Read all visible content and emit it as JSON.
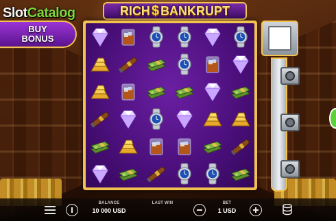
{
  "watermark": {
    "part_a": "Slot",
    "part_b": "Catalog"
  },
  "title": {
    "left": "RICH",
    "symbol": "$",
    "right": "BANKRUPT"
  },
  "buy_bonus": {
    "line1": "BUY",
    "line2": "BONUS"
  },
  "grid": {
    "rows": [
      [
        "diamond",
        "whiskey",
        "watch",
        "watch",
        "diamond",
        "watch"
      ],
      [
        "gold-bars",
        "cigar",
        "money",
        "watch",
        "whiskey",
        "diamond"
      ],
      [
        "gold-bars",
        "whiskey",
        "money",
        "money",
        "diamond",
        "money"
      ],
      [
        "cigar",
        "diamond",
        "watch",
        "diamond",
        "gold-bars",
        "gold-bars"
      ],
      [
        "money",
        "gold-bars",
        "whiskey",
        "whiskey",
        "money",
        "cigar"
      ],
      [
        "diamond",
        "money",
        "cigar",
        "watch",
        "watch",
        "money"
      ]
    ]
  },
  "meter": {
    "fill_fraction": 0.0,
    "locks": 3
  },
  "bottom_bar": {
    "balance_label": "BALANCE",
    "balance_value": "10 000 USD",
    "last_win_label": "LAST WIN",
    "last_win_value": "",
    "bet_label": "BET",
    "bet_value": "1 USD"
  },
  "colors": {
    "frame_gold": "#f2c14e",
    "grid_purple": "#4a0f7a",
    "accent_green": "#5ccf3a"
  }
}
